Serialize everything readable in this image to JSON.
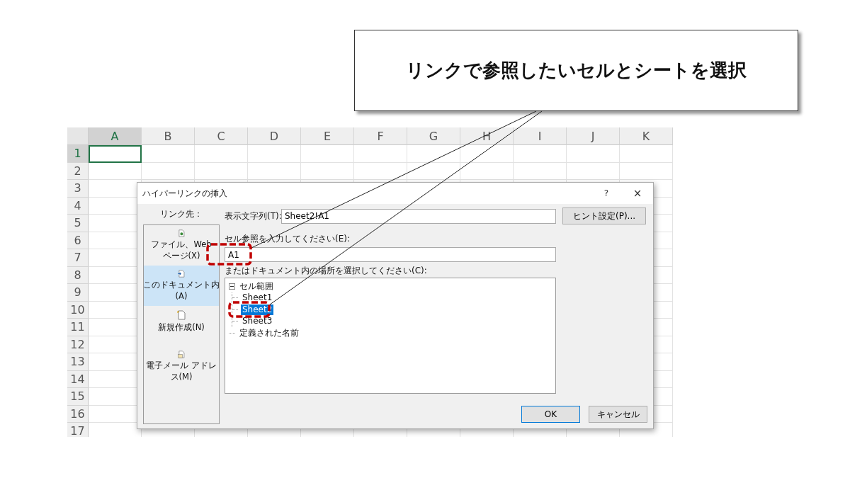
{
  "callout": {
    "text": "リンクで参照したいセルとシートを選択"
  },
  "sheet": {
    "columns": [
      {
        "label": "A",
        "selected": true
      },
      {
        "label": "B",
        "selected": false
      },
      {
        "label": "C",
        "selected": false
      },
      {
        "label": "D",
        "selected": false
      },
      {
        "label": "E",
        "selected": false
      },
      {
        "label": "F",
        "selected": false
      },
      {
        "label": "G",
        "selected": false
      },
      {
        "label": "H",
        "selected": false
      },
      {
        "label": "I",
        "selected": false
      },
      {
        "label": "J",
        "selected": false
      },
      {
        "label": "K",
        "selected": false
      }
    ],
    "rows": [
      {
        "label": "1",
        "selected": true
      },
      {
        "label": "2",
        "selected": false
      },
      {
        "label": "3",
        "selected": false
      },
      {
        "label": "4",
        "selected": false
      },
      {
        "label": "5",
        "selected": false
      },
      {
        "label": "6",
        "selected": false
      },
      {
        "label": "7",
        "selected": false
      },
      {
        "label": "8",
        "selected": false
      },
      {
        "label": "9",
        "selected": false
      },
      {
        "label": "10",
        "selected": false
      },
      {
        "label": "11",
        "selected": false
      },
      {
        "label": "12",
        "selected": false
      },
      {
        "label": "13",
        "selected": false
      },
      {
        "label": "14",
        "selected": false
      },
      {
        "label": "15",
        "selected": false
      },
      {
        "label": "16",
        "selected": false
      },
      {
        "label": "17",
        "selected": false
      }
    ]
  },
  "dialog": {
    "title": "ハイパーリンクの挿入",
    "help": "?",
    "close": "×",
    "link_to_label": "リンク先：",
    "link_targets": [
      {
        "label": [
          "ファイル、Web",
          "ページ(X)"
        ],
        "kind": "file",
        "selected": false
      },
      {
        "label": [
          "このドキュメント内",
          "(A)"
        ],
        "kind": "document",
        "selected": true
      },
      {
        "label": [
          "新規作成(N)"
        ],
        "kind": "new",
        "selected": false
      },
      {
        "label": [
          "電子メール アドレ",
          "ス(M)"
        ],
        "kind": "email",
        "selected": false
      }
    ],
    "display_text": {
      "label": "表示文字列(T):",
      "value": "Sheet2!A1"
    },
    "hint_button": "ヒント設定(P)...",
    "cell_ref": {
      "label": "セル参照を入力してください(E):",
      "value": "A1"
    },
    "place": {
      "label": "またはドキュメント内の場所を選択してください(C):",
      "tree": [
        {
          "label": "セル範囲",
          "expanded": true,
          "selected": false,
          "children": [
            {
              "label": "Sheet1",
              "selected": false
            },
            {
              "label": "Sheet2",
              "selected": true
            },
            {
              "label": "Sheet3",
              "selected": false
            }
          ]
        },
        {
          "label": "定義された名前",
          "selected": false
        }
      ]
    },
    "buttons": [
      {
        "label": "OK",
        "kind": "default"
      },
      {
        "label": "キャンセル",
        "kind": "normal"
      }
    ]
  }
}
